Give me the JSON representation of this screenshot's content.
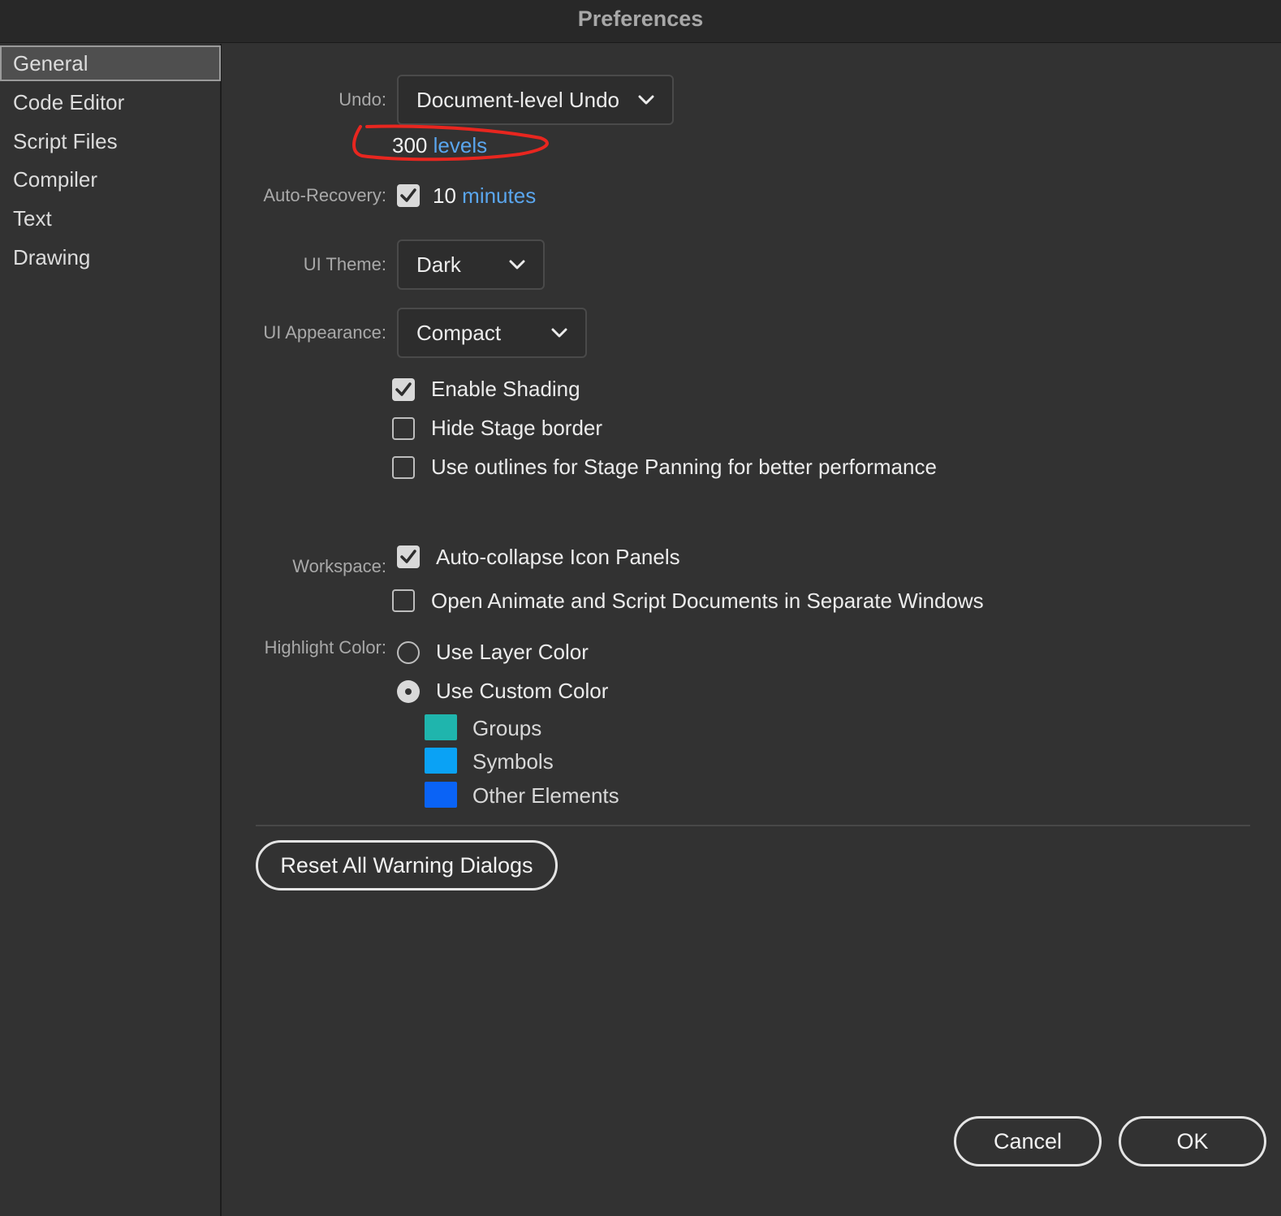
{
  "window": {
    "title": "Preferences"
  },
  "sidebar": {
    "items": [
      {
        "label": "General",
        "selected": true
      },
      {
        "label": "Code Editor"
      },
      {
        "label": "Script Files"
      },
      {
        "label": "Compiler"
      },
      {
        "label": "Text"
      },
      {
        "label": "Drawing"
      }
    ]
  },
  "general": {
    "undo": {
      "label": "Undo:",
      "value": "Document-level Undo",
      "levels_value": "300",
      "levels_unit": "levels"
    },
    "auto_recovery": {
      "label": "Auto-Recovery:",
      "checked": true,
      "value": "10",
      "unit": "minutes"
    },
    "ui_theme": {
      "label": "UI Theme:",
      "value": "Dark"
    },
    "ui_appearance": {
      "label": "UI Appearance:",
      "value": "Compact"
    },
    "options": [
      {
        "label": "Enable Shading",
        "checked": true
      },
      {
        "label": "Hide Stage border",
        "checked": false
      },
      {
        "label": "Use outlines for Stage Panning for better performance",
        "checked": false
      }
    ],
    "workspace": {
      "label": "Workspace:",
      "options": [
        {
          "label": "Auto-collapse Icon Panels",
          "checked": true
        },
        {
          "label": "Open Animate and Script Documents in Separate Windows",
          "checked": false
        }
      ]
    },
    "highlight_color": {
      "label": "Highlight Color:",
      "options": [
        {
          "label": "Use Layer Color",
          "selected": false
        },
        {
          "label": "Use Custom Color",
          "selected": true
        }
      ],
      "swatches": [
        {
          "label": "Groups",
          "color": "#1fb5ad"
        },
        {
          "label": "Symbols",
          "color": "#0aa2f5"
        },
        {
          "label": "Other Elements",
          "color": "#0a63f6"
        }
      ]
    },
    "reset_button": "Reset All Warning Dialogs"
  },
  "footer": {
    "cancel": "Cancel",
    "ok": "OK"
  },
  "colors": {
    "accent_text": "#5aa6ee",
    "annotation": "#e8261f"
  }
}
